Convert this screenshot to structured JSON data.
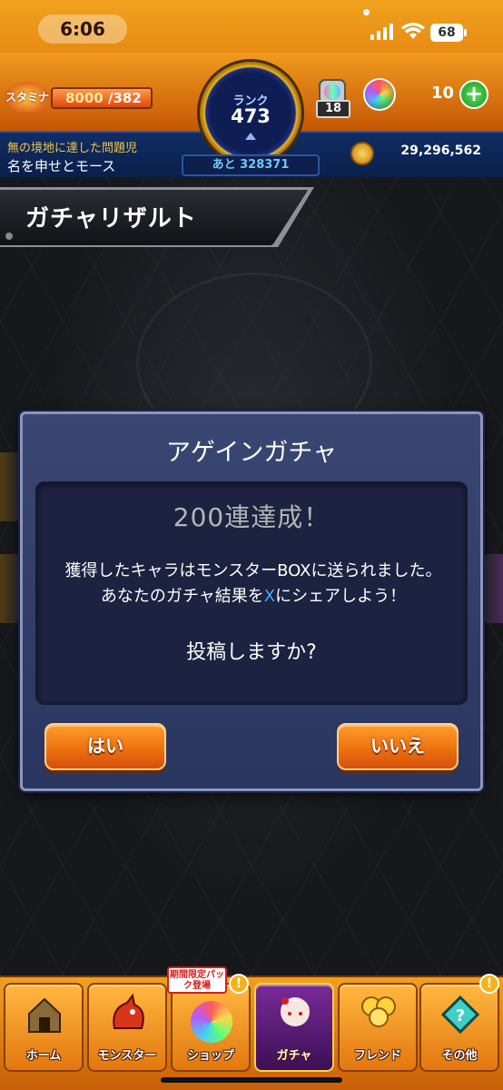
{
  "status_bar": {
    "time": "6:06",
    "battery": "68"
  },
  "header": {
    "stamina_badge": "スタミナ",
    "stamina_current": "8000",
    "stamina_max": "/382",
    "rank_label": "ランク",
    "rank_value": "473",
    "next_rank": "あと 328371",
    "box_count": "18",
    "orb_count": "10",
    "plus_label": "+",
    "player_title": "無の境地に達した問題児",
    "player_name": "名を申せとモース",
    "coins": "29,296,562"
  },
  "page_title": "ガチャリザルト",
  "dialog": {
    "title": "アゲインガチャ",
    "heading": "200連達成！",
    "line1": "獲得したキャラはモンスターBOXに送られました。",
    "line2_pre": "あなたのガチャ結果を",
    "line2_x": "X",
    "line2_post": "にシェアしよう！",
    "question": "投稿しますか?",
    "yes_label": "はい",
    "no_label": "いいえ"
  },
  "nav": {
    "promo_tag": "期間限定パック登場",
    "alert_mark": "!",
    "items": [
      {
        "label": "ホーム",
        "icon": "house-icon"
      },
      {
        "label": "モンスター",
        "icon": "monster-icon"
      },
      {
        "label": "ショップ",
        "icon": "rainbow-orb-icon"
      },
      {
        "label": "ガチャ",
        "icon": "gacha-character-icon"
      },
      {
        "label": "フレンド",
        "icon": "balloons-icon"
      },
      {
        "label": "その他",
        "icon": "misc-icon"
      }
    ]
  },
  "colors": {
    "accent_orange": "#f07611",
    "dialog_blue": "#2a3560",
    "x_blue": "#4aa6ff"
  }
}
